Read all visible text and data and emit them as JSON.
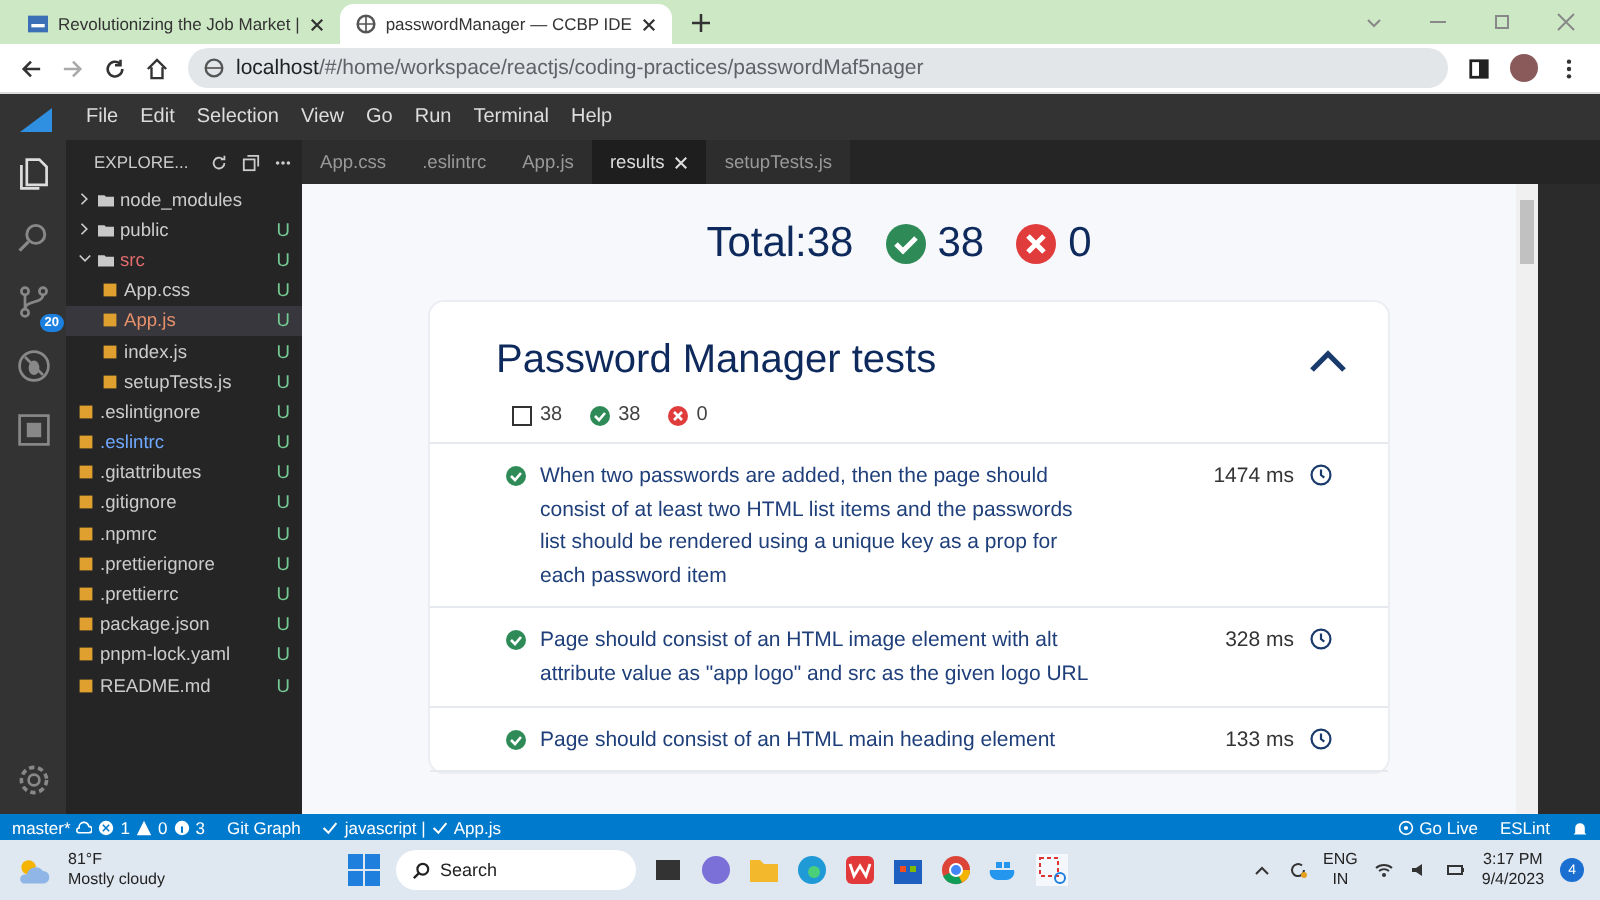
{
  "browser": {
    "tabs": [
      {
        "title": "Revolutionizing the Job Market |",
        "selected": false
      },
      {
        "title": "passwordManager — CCBP IDE",
        "selected": true
      }
    ],
    "address": {
      "host": "localhost",
      "path": "/#/home/workspace/reactjs/coding-practices/passwordMaf5nager"
    }
  },
  "ide": {
    "menu": [
      "File",
      "Edit",
      "Selection",
      "View",
      "Go",
      "Run",
      "Terminal",
      "Help"
    ],
    "source_control_badge": "20",
    "explorer": {
      "title": "EXPLORE...",
      "items": [
        {
          "name": "node_modules",
          "kind": "folder",
          "expanded": false,
          "selected": false,
          "color": "#cccccc"
        },
        {
          "name": "public",
          "kind": "folder",
          "expanded": false,
          "selected": false,
          "status": "U",
          "color": "#cccccc"
        },
        {
          "name": "src",
          "kind": "folder",
          "expanded": true,
          "selected": false,
          "status": "U",
          "color": "#e06c6c",
          "children": [
            {
              "name": "App.css",
              "kind": "file",
              "selected": false,
              "status": "U",
              "color": "#cccccc"
            },
            {
              "name": "App.js",
              "kind": "file",
              "selected": true,
              "status": "U",
              "color": "#e8906a"
            },
            {
              "name": "index.js",
              "kind": "file",
              "selected": false,
              "status": "U",
              "color": "#cccccc"
            },
            {
              "name": "setupTests.js",
              "kind": "file",
              "selected": false,
              "status": "U",
              "color": "#cccccc"
            }
          ]
        },
        {
          "name": ".eslintignore",
          "kind": "file",
          "selected": false,
          "status": "U",
          "color": "#cccccc"
        },
        {
          "name": ".eslintrc",
          "kind": "file",
          "selected": false,
          "status": "U",
          "color": "#6fa8ff"
        },
        {
          "name": ".gitattributes",
          "kind": "file",
          "selected": false,
          "status": "U",
          "color": "#cccccc"
        },
        {
          "name": ".gitignore",
          "kind": "file",
          "selected": false,
          "status": "U",
          "color": "#cccccc"
        },
        {
          "name": ".npmrc",
          "kind": "file",
          "selected": false,
          "status": "U",
          "color": "#cccccc"
        },
        {
          "name": ".prettierignore",
          "kind": "file",
          "selected": false,
          "status": "U",
          "color": "#cccccc"
        },
        {
          "name": ".prettierrc",
          "kind": "file",
          "selected": false,
          "status": "U",
          "color": "#cccccc"
        },
        {
          "name": "package.json",
          "kind": "file",
          "selected": false,
          "status": "U",
          "color": "#cccccc"
        },
        {
          "name": "pnpm-lock.yaml",
          "kind": "file",
          "selected": false,
          "status": "U",
          "color": "#cccccc"
        },
        {
          "name": "README.md",
          "kind": "file",
          "selected": false,
          "status": "U",
          "color": "#cccccc"
        }
      ]
    },
    "editor_tabs": [
      {
        "label": "App.css",
        "selected": false
      },
      {
        "label": ".eslintrc",
        "selected": false
      },
      {
        "label": "App.js",
        "selected": false
      },
      {
        "label": "results",
        "selected": true
      },
      {
        "label": "setupTests.js",
        "selected": false
      }
    ],
    "results": {
      "total": "Total:38",
      "passed": "38",
      "failed": "0",
      "suite": {
        "title": "Password Manager tests",
        "expanded": true,
        "count_total": "38",
        "count_passed": "38",
        "count_failed": "0",
        "tests": [
          {
            "text": "When two passwords are added, then the page should consist of at least two HTML list items and the passwords list should be rendered using a unique key as a prop for each password item",
            "time": "1474 ms",
            "passed": true
          },
          {
            "text": "Page should consist of an HTML image element with alt attribute value as \"app logo\" and src as the given logo URL",
            "time": "328 ms",
            "passed": true
          },
          {
            "text": "Page should consist of an HTML main heading element",
            "time": "133 ms",
            "passed": true
          }
        ]
      }
    },
    "status_bar": {
      "branch": "master*",
      "errors": "1",
      "warnings": "0",
      "infos": "3",
      "git_graph": "Git Graph",
      "language": "javascript |",
      "file": "App.js",
      "go_live": "Go Live",
      "eslint": "ESLint"
    }
  },
  "taskbar": {
    "temperature": "81°F",
    "weather": "Mostly cloudy",
    "search": "Search",
    "language": "ENG",
    "region": "IN",
    "time": "3:17 PM",
    "date": "9/4/2023",
    "notifications": "4"
  }
}
